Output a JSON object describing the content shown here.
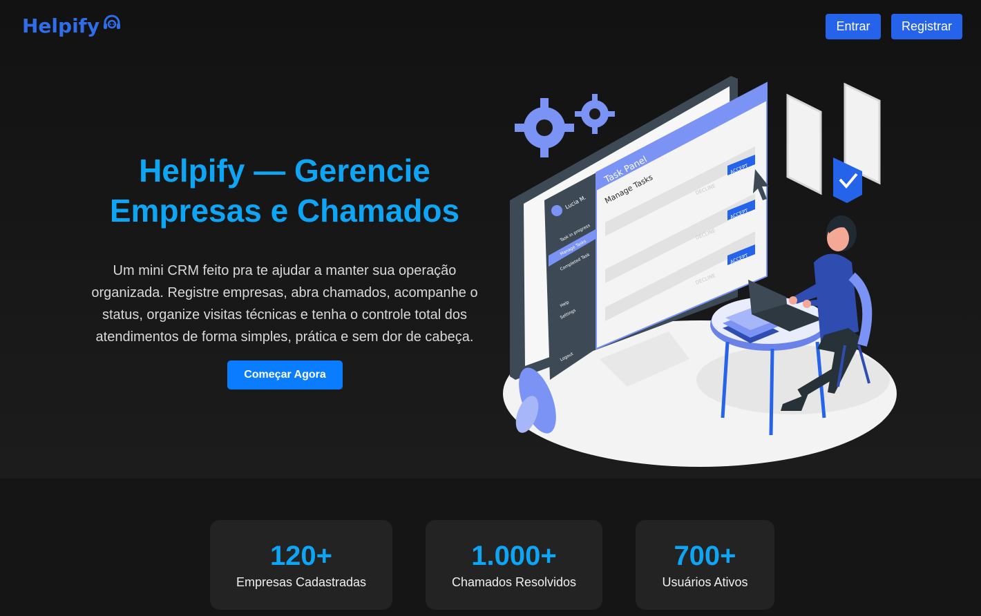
{
  "header": {
    "logo_text": "Helpify",
    "login_label": "Entrar",
    "register_label": "Registrar"
  },
  "hero": {
    "title": "Helpify — Gerencie Empresas e Chamados",
    "description": "Um mini CRM feito pra te ajudar a manter sua operação organizada. Registre empresas, abra chamados, acompanhe o status, organize visitas técnicas e tenha o controle total dos atendimentos de forma simples, prática e sem dor de cabeça.",
    "cta_label": "Começar Agora"
  },
  "illustration": {
    "user_name": "Lucia M.",
    "menu": [
      "Task in progress",
      "Manage Tasks",
      "Completed Task",
      "Help",
      "Settings",
      "Logout"
    ],
    "panel_title": "Task Panel",
    "panel_subtitle": "Manage Tasks",
    "accept_label": "ACCEPT",
    "decline_label": "DECLINE"
  },
  "stats": [
    {
      "value": "120+",
      "label": "Empresas Cadastradas"
    },
    {
      "value": "1.000+",
      "label": "Chamados Resolvidos"
    },
    {
      "value": "700+",
      "label": "Usuários Ativos"
    }
  ],
  "colors": {
    "brand": "#2563eb",
    "accent": "#0ea5f5",
    "illustration_blue": "#7b93f5"
  }
}
